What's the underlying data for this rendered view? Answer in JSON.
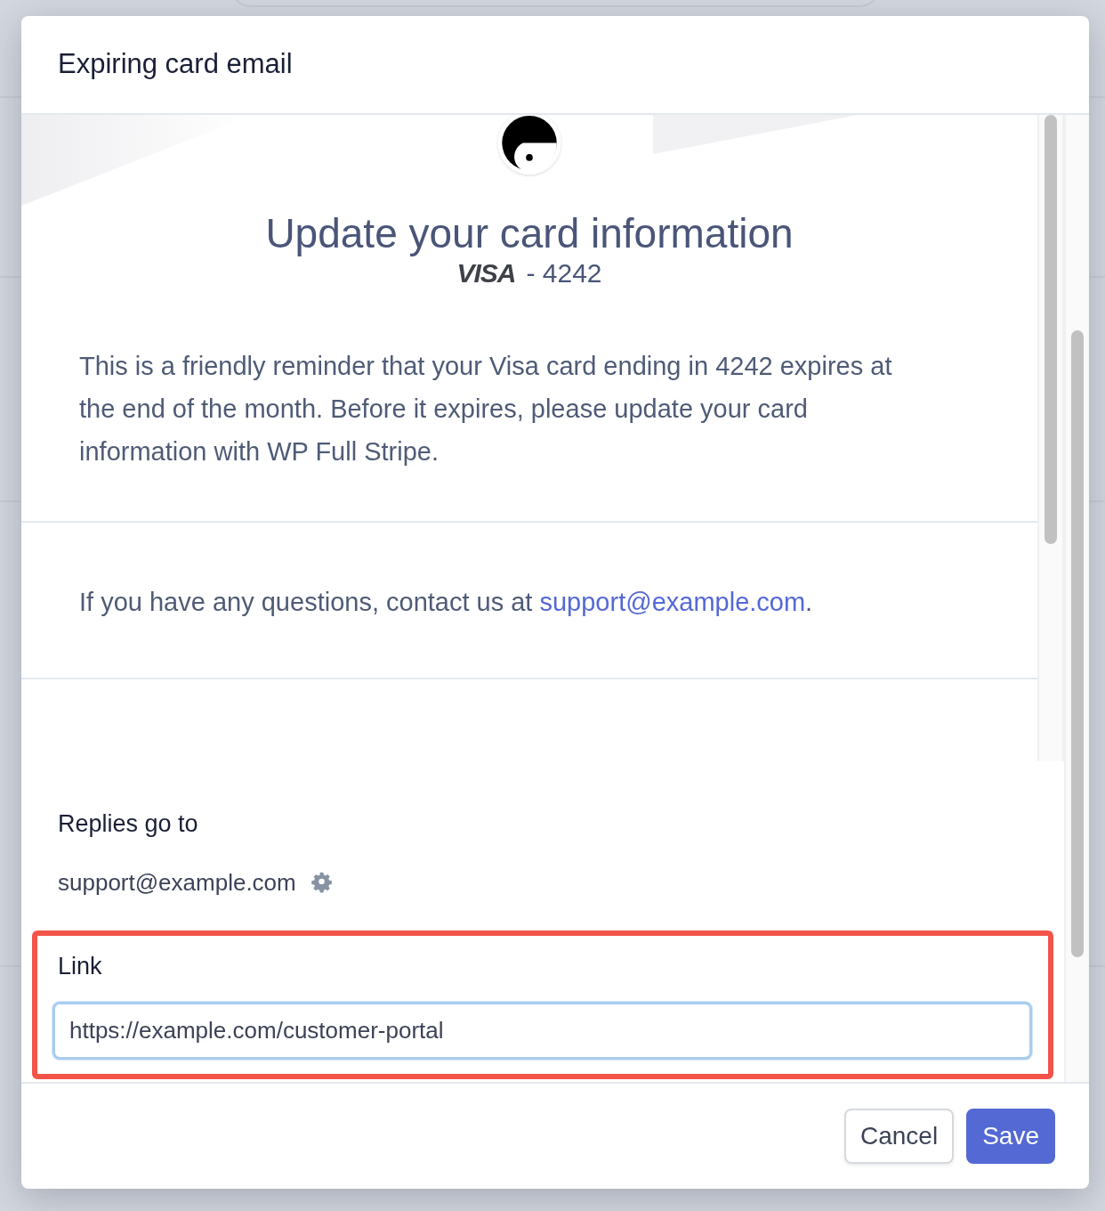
{
  "dialog": {
    "title": "Expiring card email"
  },
  "email_preview": {
    "heading": "Update your card information",
    "card_brand": "VISA",
    "card_suffix": "- 4242",
    "message": "This is a friendly reminder that your Visa card ending in 4242 expires at the end of the month. Before it expires, please update your card information with WP Full Stripe.",
    "contact_text": "If you have any questions, contact us at ",
    "contact_email": "support@example.com",
    "contact_end": "."
  },
  "form": {
    "replies_label": "Replies go to",
    "replies_value": "support@example.com",
    "link_label": "Link",
    "link_value": "https://example.com/customer-portal",
    "link_highlighted": true
  },
  "buttons": [
    {
      "label": "Cancel",
      "kind": "secondary"
    },
    {
      "label": "Save",
      "kind": "primary"
    }
  ]
}
